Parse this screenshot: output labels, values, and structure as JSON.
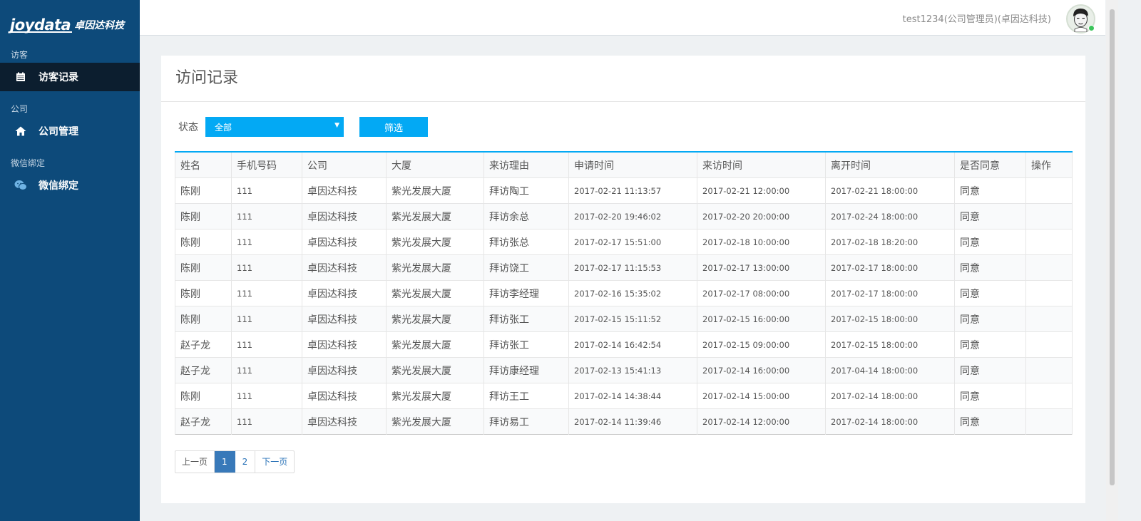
{
  "brand": {
    "logo_word": "joydata",
    "logo_cn": "卓因达科技"
  },
  "sidebar": {
    "groups": [
      {
        "title": "访客",
        "item": {
          "label": "访客记录",
          "icon": "calendar-icon",
          "active": true
        }
      },
      {
        "title": "公司",
        "item": {
          "label": "公司管理",
          "icon": "home-icon",
          "active": false
        }
      },
      {
        "title": "微信绑定",
        "item": {
          "label": "微信绑定",
          "icon": "wechat-icon",
          "active": false
        }
      }
    ]
  },
  "header": {
    "user": "test1234(公司管理员)(卓因达科技)"
  },
  "page": {
    "title": "访问记录"
  },
  "filter": {
    "label": "状态",
    "selected": "全部",
    "button": "筛选"
  },
  "table": {
    "columns": [
      "姓名",
      "手机号码",
      "公司",
      "大厦",
      "来访理由",
      "申请时间",
      "来访时间",
      "离开时间",
      "是否同意",
      "操作"
    ],
    "rows": [
      [
        "陈刚",
        "111",
        "卓因达科技",
        "紫光发展大厦",
        "拜访陶工",
        "2017-02-21 11:13:57",
        "2017-02-21 12:00:00",
        "2017-02-21 18:00:00",
        "同意",
        ""
      ],
      [
        "陈刚",
        "111",
        "卓因达科技",
        "紫光发展大厦",
        "拜访余总",
        "2017-02-20 19:46:02",
        "2017-02-20 20:00:00",
        "2017-02-24 18:00:00",
        "同意",
        ""
      ],
      [
        "陈刚",
        "111",
        "卓因达科技",
        "紫光发展大厦",
        "拜访张总",
        "2017-02-17 15:51:00",
        "2017-02-18 10:00:00",
        "2017-02-18 18:20:00",
        "同意",
        ""
      ],
      [
        "陈刚",
        "111",
        "卓因达科技",
        "紫光发展大厦",
        "拜访饶工",
        "2017-02-17 11:15:53",
        "2017-02-17 13:00:00",
        "2017-02-17 18:00:00",
        "同意",
        ""
      ],
      [
        "陈刚",
        "111",
        "卓因达科技",
        "紫光发展大厦",
        "拜访李经理",
        "2017-02-16 15:35:02",
        "2017-02-17 08:00:00",
        "2017-02-17 18:00:00",
        "同意",
        ""
      ],
      [
        "陈刚",
        "111",
        "卓因达科技",
        "紫光发展大厦",
        "拜访张工",
        "2017-02-15 15:11:52",
        "2017-02-15 16:00:00",
        "2017-02-15 18:00:00",
        "同意",
        ""
      ],
      [
        "赵子龙",
        "111",
        "卓因达科技",
        "紫光发展大厦",
        "拜访张工",
        "2017-02-14 16:42:54",
        "2017-02-15 09:00:00",
        "2017-02-15 18:00:00",
        "同意",
        ""
      ],
      [
        "赵子龙",
        "111",
        "卓因达科技",
        "紫光发展大厦",
        "拜访康经理",
        "2017-02-13 15:41:13",
        "2017-02-14 16:00:00",
        "2017-04-14 18:00:00",
        "同意",
        ""
      ],
      [
        "陈刚",
        "111",
        "卓因达科技",
        "紫光发展大厦",
        "拜访王工",
        "2017-02-14 14:38:44",
        "2017-02-14 15:00:00",
        "2017-02-14 18:00:00",
        "同意",
        ""
      ],
      [
        "赵子龙",
        "111",
        "卓因达科技",
        "紫光发展大厦",
        "拜访易工",
        "2017-02-14 11:39:46",
        "2017-02-14 12:00:00",
        "2017-02-14 18:00:00",
        "同意",
        ""
      ]
    ]
  },
  "pagination": {
    "prev": "上一页",
    "pages": [
      "1",
      "2"
    ],
    "current": "1",
    "next": "下一页"
  },
  "colors": {
    "sidebar": "#0d4a7a",
    "active_item": "#0c1e2f",
    "accent": "#03a9f4",
    "page_current": "#3879b9"
  }
}
